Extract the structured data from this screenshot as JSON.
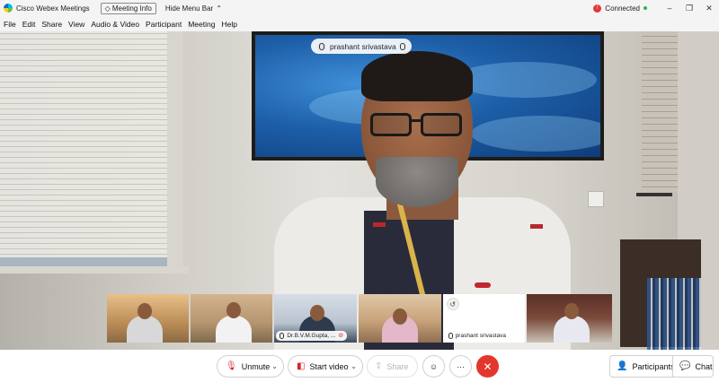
{
  "titlebar": {
    "app_name": "Cisco Webex Meetings",
    "meeting_info": "Meeting Info",
    "hide_menu_bar": "Hide Menu Bar",
    "status": "Connected",
    "minimize": "–",
    "restore": "❐",
    "close": "✕"
  },
  "menubar": {
    "items": [
      "File",
      "Edit",
      "Share",
      "View",
      "Audio & Video",
      "Participant",
      "Meeting",
      "Help"
    ]
  },
  "video": {
    "active_speaker": "prashant srivastava"
  },
  "filmstrip": {
    "labels": [
      "Dr.B.V.M.Gupta, ...",
      "prashant srivastava"
    ]
  },
  "controls": {
    "unmute": "Unmute",
    "start_video": "Start video",
    "share": "Share",
    "participants": "Participants",
    "chat": "Chat",
    "leave_glyph": "✕",
    "more_glyph": "···",
    "reactions_glyph": "☺"
  },
  "colors": {
    "leave_red": "#e2372c",
    "connected_green": "#2fb153",
    "muted_red": "#d9262c"
  }
}
